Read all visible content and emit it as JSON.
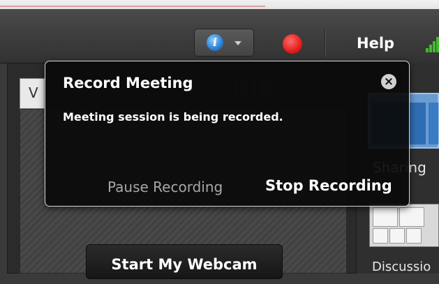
{
  "toolbar": {
    "info_icon": "info-icon",
    "caret_icon": "chevron-down-icon",
    "record_icon": "record-icon",
    "help_label": "Help",
    "signal_icon": "signal-strength-icon"
  },
  "left_pod": {
    "tab_label": "V",
    "webcam_button": "Start My Webcam"
  },
  "right_pod": {
    "layout_sharing": "Sharing",
    "layout_discussion": "Discussio"
  },
  "popup": {
    "title": "Record Meeting",
    "message": "Meeting session is being recorded.",
    "pause_label": "Pause Recording",
    "stop_label": "Stop Recording",
    "close_icon": "close-icon"
  },
  "colors": {
    "record": "#e01818",
    "info": "#2a7fd0",
    "signal": "#3fbf2a",
    "popup_bg": "#0a0a0a"
  }
}
